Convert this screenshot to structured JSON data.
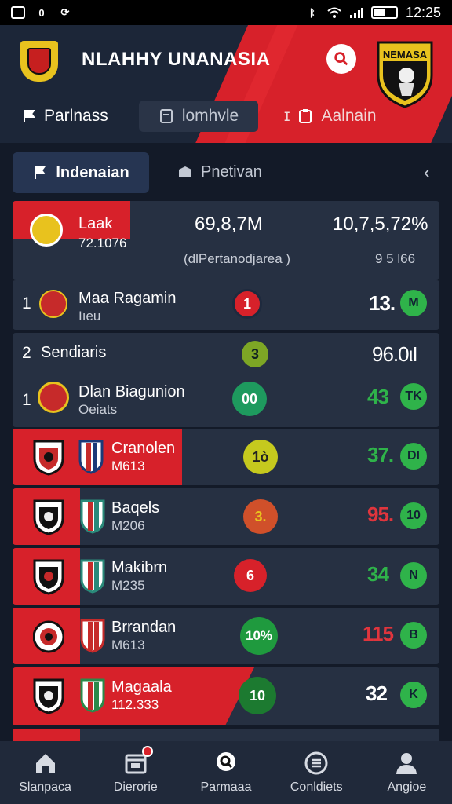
{
  "status_bar": {
    "time": "12:25",
    "icons": [
      "image-icon",
      "data-icon",
      "sync-icon",
      "bluetooth-icon",
      "wifi-icon",
      "signal-icon",
      "battery-icon"
    ]
  },
  "header": {
    "title": "NLAHHY UNANASIA",
    "crest_text": "NEMASA",
    "nav": {
      "left_label": "Parlnass",
      "middle_label": "lomhvle",
      "right_prefix": "ɪ",
      "right_label": "Aalnain"
    }
  },
  "tabs": {
    "active": "Indenaian",
    "second": "Pnetivan"
  },
  "summary": {
    "name": "Laak",
    "sub": "72.1076",
    "amount": "69,8,7M",
    "percent": "10,7,5,72%",
    "caption": "(dlPertanodjarea )",
    "caption_right": "9 5 l66"
  },
  "rows": [
    {
      "rank": "1",
      "name": "Maa Ragamin",
      "sub": "Iıeu",
      "badge": "1",
      "value": "13.",
      "mini": "M"
    },
    {
      "rank": "2",
      "name": "Sendiaris",
      "badge": "3",
      "value": "96.0ιI"
    },
    {
      "rank": "1",
      "name": "Dlan Biagunion",
      "sub": "Oeiats",
      "badge": "00",
      "value": "43",
      "mini": "TK"
    },
    {
      "name": "Cranolen",
      "sub": "M613",
      "badge": "1ò",
      "value": "37.",
      "mini": "DI"
    },
    {
      "name": "Baqels",
      "sub": "M206",
      "badge": "3.",
      "value": "95.",
      "mini": "10"
    },
    {
      "name": "Makibrn",
      "sub": "M235",
      "badge": "6",
      "value": "34",
      "mini": "N"
    },
    {
      "name": "Brrandan",
      "sub": "M613",
      "badge": "10%",
      "value": "115",
      "mini": "B"
    },
    {
      "name": "Magaala",
      "sub": "112.333",
      "badge": "10",
      "value": "32",
      "mini": "K"
    }
  ],
  "bottom_nav": [
    {
      "label": "Slanpaca",
      "icon": "home-icon"
    },
    {
      "label": "Dierorie",
      "icon": "calendar-icon"
    },
    {
      "label": "Parmaaa",
      "icon": "search-icon"
    },
    {
      "label": "Conldiets",
      "icon": "list-icon"
    },
    {
      "label": "Angioe",
      "icon": "profile-icon"
    }
  ],
  "colors": {
    "background": "#131a28",
    "card": "#263042",
    "accent_red": "#d7212a",
    "positive_green": "#2fb34a",
    "negative_red": "#e0353d"
  }
}
